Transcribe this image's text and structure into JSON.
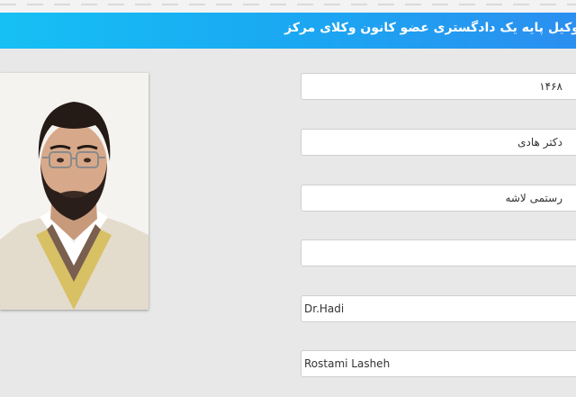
{
  "header": {
    "title": "وکیل پایه یک دادگستری عضو کانون وکلای مرکز"
  },
  "profile": {
    "photo_alt": ""
  },
  "fields": [
    {
      "name": "license-number-field",
      "value": "۱۴۶۸",
      "dir": "rtl"
    },
    {
      "name": "first-name-fa-field",
      "value": "دکتر هادی",
      "dir": "rtl"
    },
    {
      "name": "last-name-fa-field",
      "value": "رستمی لاشه",
      "dir": "rtl"
    },
    {
      "name": "empty-field",
      "value": "",
      "dir": "rtl"
    },
    {
      "name": "first-name-en-field",
      "value": "Dr.Hadi",
      "dir": "ltr"
    },
    {
      "name": "last-name-en-field",
      "value": "Rostami Lasheh",
      "dir": "ltr"
    }
  ],
  "colors": {
    "header_gradient_start": "#16c0f4",
    "header_gradient_end": "#2b8ff0",
    "page_background": "#e8e8e9",
    "field_background": "#ffffff",
    "field_border": "#cfcfcf"
  }
}
